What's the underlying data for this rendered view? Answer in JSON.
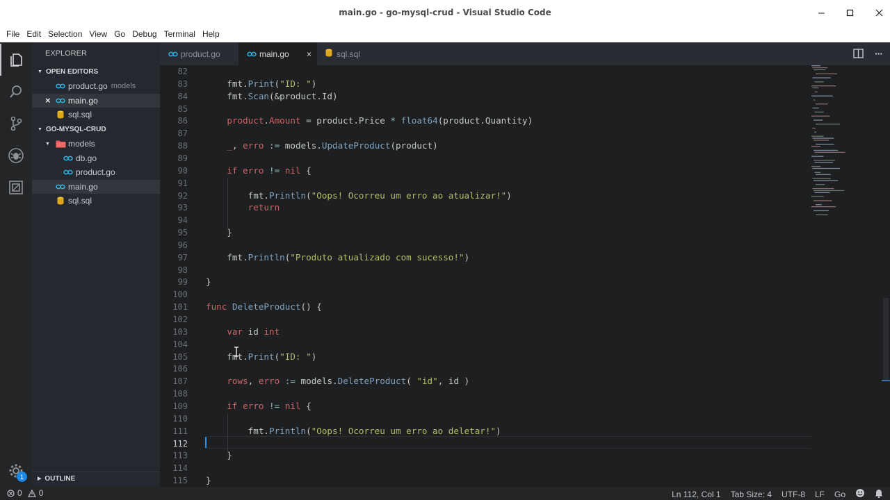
{
  "window": {
    "title": "main.go - go-mysql-crud - Visual Studio Code"
  },
  "menu": [
    "File",
    "Edit",
    "Selection",
    "View",
    "Go",
    "Debug",
    "Terminal",
    "Help"
  ],
  "sidebar": {
    "header": "EXPLORER",
    "open_editors_label": "OPEN EDITORS",
    "open_editors": [
      {
        "name": "product.go",
        "desc": "models",
        "icon": "go-file-icon"
      },
      {
        "name": "main.go",
        "desc": "",
        "icon": "go-file-icon"
      },
      {
        "name": "sql.sql",
        "desc": "",
        "icon": "database-icon"
      }
    ],
    "project_label": "GO-MYSQL-CRUD",
    "tree": [
      {
        "name": "models",
        "icon": "folder-icon"
      },
      {
        "name": "db.go",
        "icon": "go-file-icon"
      },
      {
        "name": "product.go",
        "icon": "go-file-icon"
      },
      {
        "name": "main.go",
        "icon": "go-file-icon"
      },
      {
        "name": "sql.sql",
        "icon": "database-icon"
      }
    ],
    "outline_label": "OUTLINE"
  },
  "tabs": [
    {
      "label": "product.go",
      "icon": "go-file-icon"
    },
    {
      "label": "main.go",
      "icon": "go-file-icon",
      "close": "×"
    },
    {
      "label": "sql.sql",
      "icon": "database-icon"
    }
  ],
  "activity": {
    "badge": "1"
  },
  "code_lines": [
    {
      "n": "82",
      "text": ""
    },
    {
      "n": "83",
      "text": "    fmt.Print(\"ID: \")"
    },
    {
      "n": "84",
      "text": "    fmt.Scan(&product.Id)"
    },
    {
      "n": "85",
      "text": ""
    },
    {
      "n": "86",
      "text": "    product.Amount = product.Price * float64(product.Quantity)"
    },
    {
      "n": "87",
      "text": ""
    },
    {
      "n": "88",
      "text": "    _, erro := models.UpdateProduct(product)"
    },
    {
      "n": "89",
      "text": ""
    },
    {
      "n": "90",
      "text": "    if erro != nil {"
    },
    {
      "n": "91",
      "text": ""
    },
    {
      "n": "92",
      "text": "        fmt.Println(\"Oops! Ocorreu um erro ao atualizar!\")"
    },
    {
      "n": "93",
      "text": "        return"
    },
    {
      "n": "94",
      "text": ""
    },
    {
      "n": "95",
      "text": "    }"
    },
    {
      "n": "96",
      "text": ""
    },
    {
      "n": "97",
      "text": "    fmt.Println(\"Produto atualizado com sucesso!\")"
    },
    {
      "n": "98",
      "text": ""
    },
    {
      "n": "99",
      "text": "}"
    },
    {
      "n": "100",
      "text": ""
    },
    {
      "n": "101",
      "text": "func DeleteProduct() {"
    },
    {
      "n": "102",
      "text": ""
    },
    {
      "n": "103",
      "text": "    var id int"
    },
    {
      "n": "104",
      "text": ""
    },
    {
      "n": "105",
      "text": "    fmt.Print(\"ID: \")"
    },
    {
      "n": "106",
      "text": ""
    },
    {
      "n": "107",
      "text": "    rows, erro := models.DeleteProduct( \"id\", id )"
    },
    {
      "n": "108",
      "text": ""
    },
    {
      "n": "109",
      "text": "    if erro != nil {"
    },
    {
      "n": "110",
      "text": ""
    },
    {
      "n": "111",
      "text": "        fmt.Println(\"Oops! Ocorreu um erro ao deletar!\")"
    },
    {
      "n": "112",
      "text": ""
    },
    {
      "n": "113",
      "text": "    }"
    },
    {
      "n": "114",
      "text": ""
    },
    {
      "n": "115",
      "text": "}"
    }
  ],
  "status": {
    "errors": "0",
    "warnings": "0",
    "position": "Ln 112, Col 1",
    "tab_size": "Tab Size: 4",
    "encoding": "UTF-8",
    "eol": "LF",
    "language": "Go"
  },
  "colors": {
    "keyword": "#cc6666",
    "func": "#81a2be",
    "string": "#b5bd68",
    "type": "#de935f",
    "accent": "#1e88e5"
  }
}
